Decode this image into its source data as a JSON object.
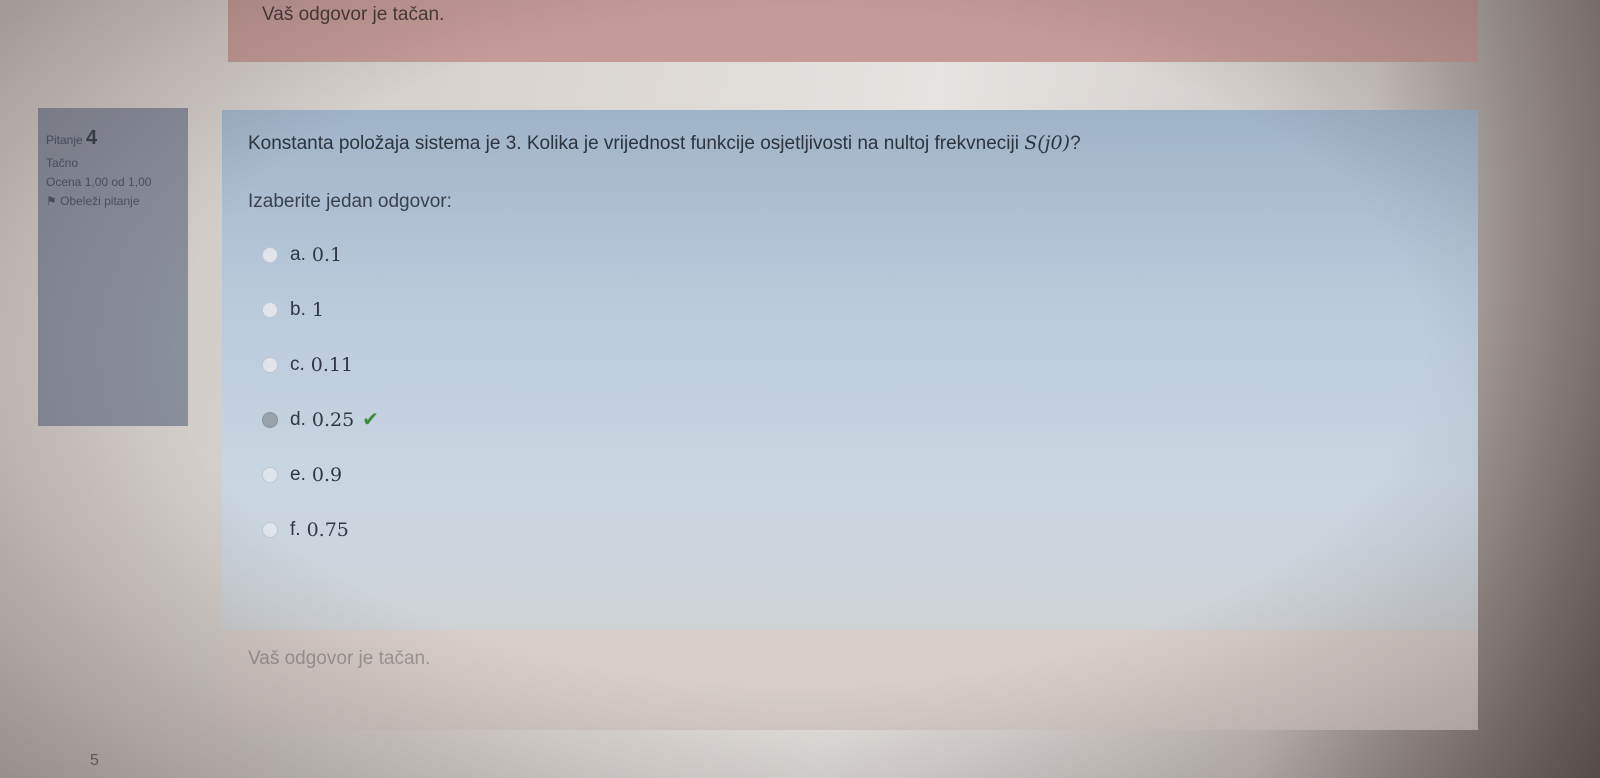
{
  "previous_feedback": "Vaš odgovor je tačan.",
  "question": {
    "label": "Pitanje",
    "number": "4",
    "state": "Tačno",
    "grade": "Ocena 1,00 od 1,00",
    "flag": "Obeleži pitanje",
    "text": "Konstanta položaja sistema je 3. Kolika je vrijednost funkcije osjetljivosti na nultoj frekvneciji ",
    "math": "S(j0)",
    "text_end": "?",
    "prompt": "Izaberite jedan odgovor:",
    "answers": [
      {
        "letter": "a.",
        "value": "0.1"
      },
      {
        "letter": "b.",
        "value": "1"
      },
      {
        "letter": "c.",
        "value": "0.11"
      },
      {
        "letter": "d.",
        "value": "0.25",
        "selected": true,
        "correct_icon": "check-icon"
      },
      {
        "letter": "e.",
        "value": "0.9"
      },
      {
        "letter": "f.",
        "value": "0.75"
      }
    ],
    "feedback": "Vaš odgovor je tačan."
  },
  "next_question_number": "5",
  "colors": {
    "correct": "#3d8a3d",
    "feedback_bg": "#c49b98",
    "info_bg": "#8a8f9c"
  }
}
